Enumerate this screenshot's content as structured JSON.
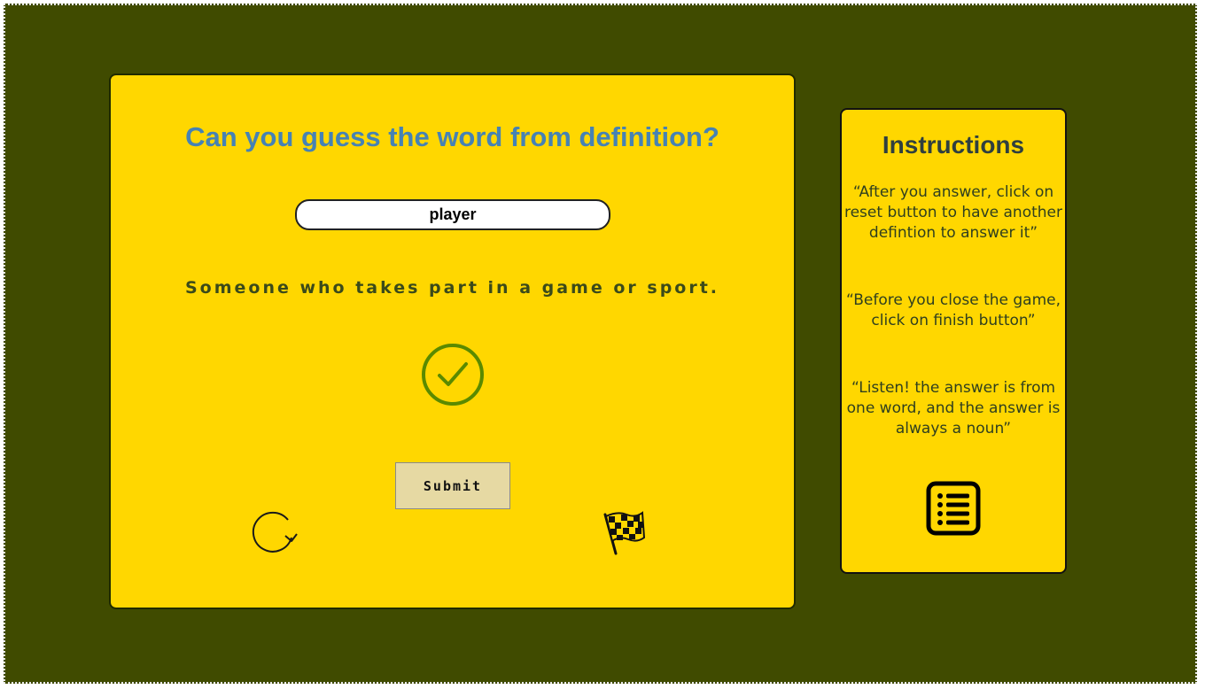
{
  "game": {
    "title": "Can you guess the word from definition?",
    "answer_value": "player",
    "definition": "Someone who takes part in a game or sport.",
    "result_icon": "check-circle-icon",
    "submit_label": "Submit",
    "reset_icon": "reset-icon",
    "finish_icon": "checkered-flag-icon"
  },
  "instructions": {
    "title": "Instructions",
    "items": [
      "“After you answer, click on reset button to have another defintion to answer it”",
      "“Before you close the game, click on finish button”",
      "“Listen! the answer is from one word, and the answer is always a noun”"
    ],
    "list_icon": "list-icon"
  },
  "colors": {
    "background": "#404b00",
    "card": "#ffd700",
    "title": "#4682b4",
    "check": "#5a8a00",
    "submit": "#e6d9a3"
  }
}
